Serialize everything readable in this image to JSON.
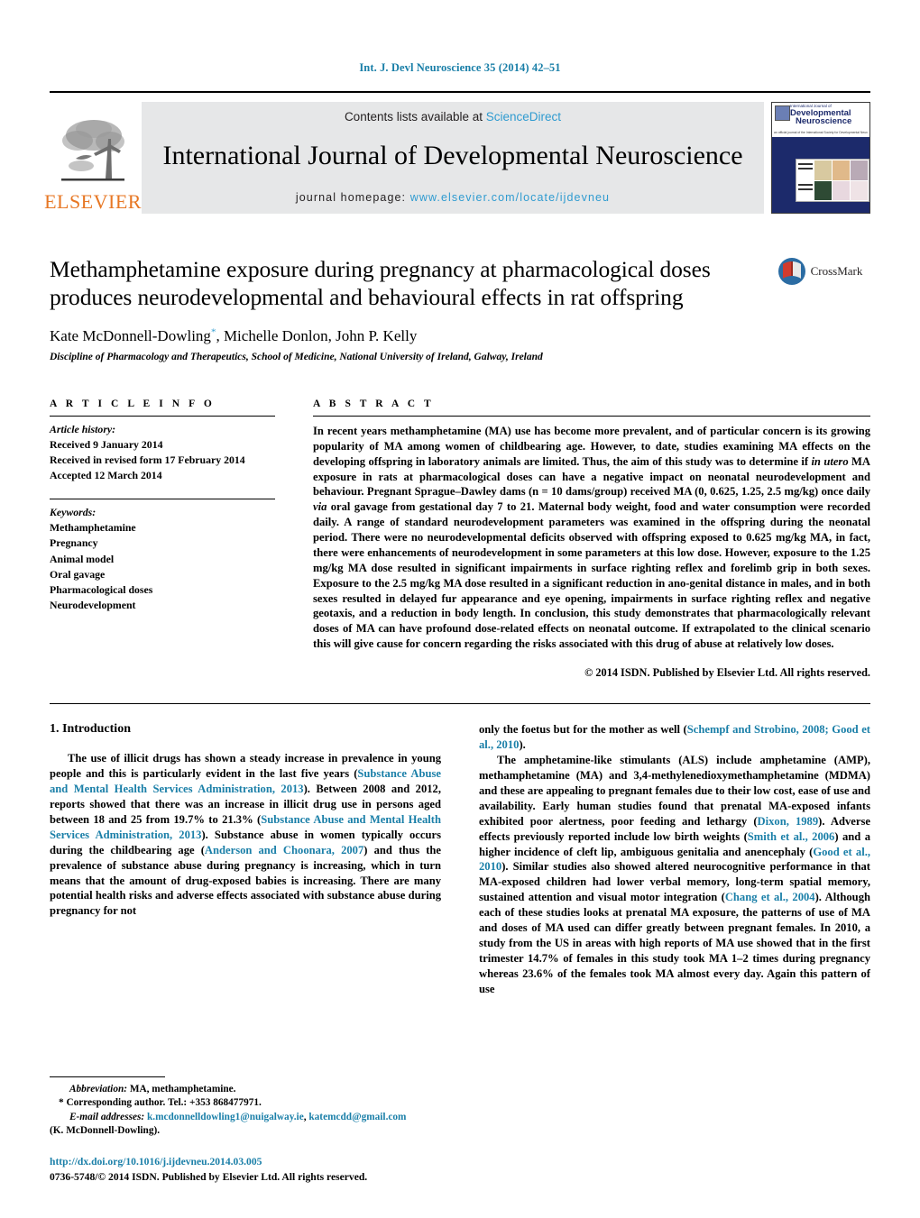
{
  "running_head": "Int. J. Devl Neuroscience 35 (2014) 42–51",
  "banner": {
    "publisher_word": "ELSEVIER",
    "contents_prefix": "Contents lists available at ",
    "contents_link": "ScienceDirect",
    "journal_name": "International Journal of Developmental Neuroscience",
    "homepage_prefix": "journal homepage: ",
    "homepage_url": "www.elsevier.com/locate/ijdevneu",
    "cover_title_line1": "International Journal of",
    "cover_title_line2": "Developmental",
    "cover_title_line3": "Neuroscience",
    "cover_subtitle": "an official journal of the International Society for Developmental Neuroscience"
  },
  "article": {
    "title": "Methamphetamine exposure during pregnancy at pharmacological doses produces neurodevelopmental and behavioural effects in rat offspring",
    "authors": "Kate McDonnell-Dowling, Michelle Donlon, John P. Kelly",
    "author_marker": "*",
    "affiliation": "Discipline of Pharmacology and Therapeutics, School of Medicine, National University of Ireland, Galway, Ireland",
    "crossmark_label": "CrossMark"
  },
  "article_info": {
    "heading": "A R T I C L E   I N F O",
    "history_label": "Article history:",
    "history": [
      "Received 9 January 2014",
      "Received in revised form 17 February 2014",
      "Accepted 12 March 2014"
    ],
    "keywords_label": "Keywords:",
    "keywords": [
      "Methamphetamine",
      "Pregnancy",
      "Animal model",
      "Oral gavage",
      "Pharmacological doses",
      "Neurodevelopment"
    ]
  },
  "abstract": {
    "heading": "A B S T R A C T",
    "part1": "In recent years methamphetamine (MA) use has become more prevalent, and of particular concern is its growing popularity of MA among women of childbearing age. However, to date, studies examining MA effects on the developing offspring in laboratory animals are limited. Thus, the aim of this study was to determine if ",
    "italic1": "in utero",
    "part2": " MA exposure in rats at pharmacological doses can have a negative impact on neonatal neurodevelopment and behaviour. Pregnant Sprague–Dawley dams (n = 10 dams/group) received MA (0, 0.625, 1.25, 2.5 mg/kg) once daily ",
    "italic2": "via",
    "part3": " oral gavage from gestational day 7 to 21. Maternal body weight, food and water consumption were recorded daily. A range of standard neurodevelopment parameters was examined in the offspring during the neonatal period. There were no neurodevelopmental deficits observed with offspring exposed to 0.625 mg/kg MA, in fact, there were enhancements of neurodevelopment in some parameters at this low dose. However, exposure to the 1.25 mg/kg MA dose resulted in significant impairments in surface righting reflex and forelimb grip in both sexes. Exposure to the 2.5 mg/kg MA dose resulted in a significant reduction in ano-genital distance in males, and in both sexes resulted in delayed fur appearance and eye opening, impairments in surface righting reflex and negative geotaxis, and a reduction in body length. In conclusion, this study demonstrates that pharmacologically relevant doses of MA can have profound dose-related effects on neonatal outcome. If extrapolated to the clinical scenario this will give cause for concern regarding the risks associated with this drug of abuse at relatively low doses.",
    "copyright": "© 2014 ISDN. Published by Elsevier Ltd. All rights reserved."
  },
  "introduction": {
    "section_title": "1.  Introduction",
    "left_p1_a": "The use of illicit drugs has shown a steady increase in prevalence in young people and this is particularly evident in the last five years (",
    "left_cite1": "Substance Abuse and Mental Health Services Administration, 2013",
    "left_p1_b": "). Between 2008 and 2012, reports showed that there was an increase in illicit drug use in persons aged between 18 and 25 from 19.7% to 21.3% (",
    "left_cite2": "Substance Abuse and Mental Health Services Administration, 2013",
    "left_p1_c": "). Substance abuse in women typically occurs during the childbearing age (",
    "left_cite3": "Anderson and Choonara, 2007",
    "left_p1_d": ") and thus the prevalence of substance abuse during pregnancy is increasing, which in turn means that the amount of drug-exposed babies is increasing. There are many potential health risks and adverse effects associated with substance abuse during pregnancy for not",
    "right_p1_a": "only the foetus but for the mother as well (",
    "right_cite1": "Schempf and Strobino, 2008; Good et al., 2010",
    "right_p1_b": ").",
    "right_p2_a": "The amphetamine-like stimulants (ALS) include amphetamine (AMP), methamphetamine (MA) and 3,4-methylenedioxymethamphetamine (MDMA) and these are appealing to pregnant females due to their low cost, ease of use and availability. Early human studies found that prenatal MA-exposed infants exhibited poor alertness, poor feeding and lethargy (",
    "right_cite2": "Dixon, 1989",
    "right_p2_b": "). Adverse effects previously reported include low birth weights (",
    "right_cite3": "Smith et al., 2006",
    "right_p2_c": ") and a higher incidence of cleft lip, ambiguous genitalia and anencephaly (",
    "right_cite4": "Good et al., 2010",
    "right_p2_d": "). Similar studies also showed altered neurocognitive performance in that MA-exposed children had lower verbal memory, long-term spatial memory, sustained attention and visual motor integration (",
    "right_cite5": "Chang et al., 2004",
    "right_p2_e": "). Although each of these studies looks at prenatal MA exposure, the patterns of use of MA and doses of MA used can differ greatly between pregnant females. In 2010, a study from the US in areas with high reports of MA use showed that in the first trimester 14.7% of females in this study took MA 1–2 times during pregnancy whereas 23.6% of the females took MA almost every day. Again this pattern of use"
  },
  "footnotes": {
    "abbrev_label": "Abbreviation:",
    "abbrev_text": " MA, methamphetamine.",
    "corresponding": "* Corresponding author. Tel.: +353 868477971.",
    "email_label": "E-mail addresses:",
    "email1": "k.mcdonnelldowling1@nuigalway.ie",
    "email_sep": ", ",
    "email2": "katemcdd@gmail.com",
    "email_suffix": "(K. McDonnell-Dowling).",
    "doi": "http://dx.doi.org/10.1016/j.ijdevneu.2014.03.005",
    "issn_line": "0736-5748/© 2014 ISDN. Published by Elsevier Ltd. All rights reserved."
  },
  "colors": {
    "link_blue": "#1a7fa8",
    "sciencedirect_blue": "#2f9bd0",
    "elsevier_orange": "#e77724",
    "banner_gray": "#e6e7e8",
    "cover_navy": "#1c2a6b"
  }
}
